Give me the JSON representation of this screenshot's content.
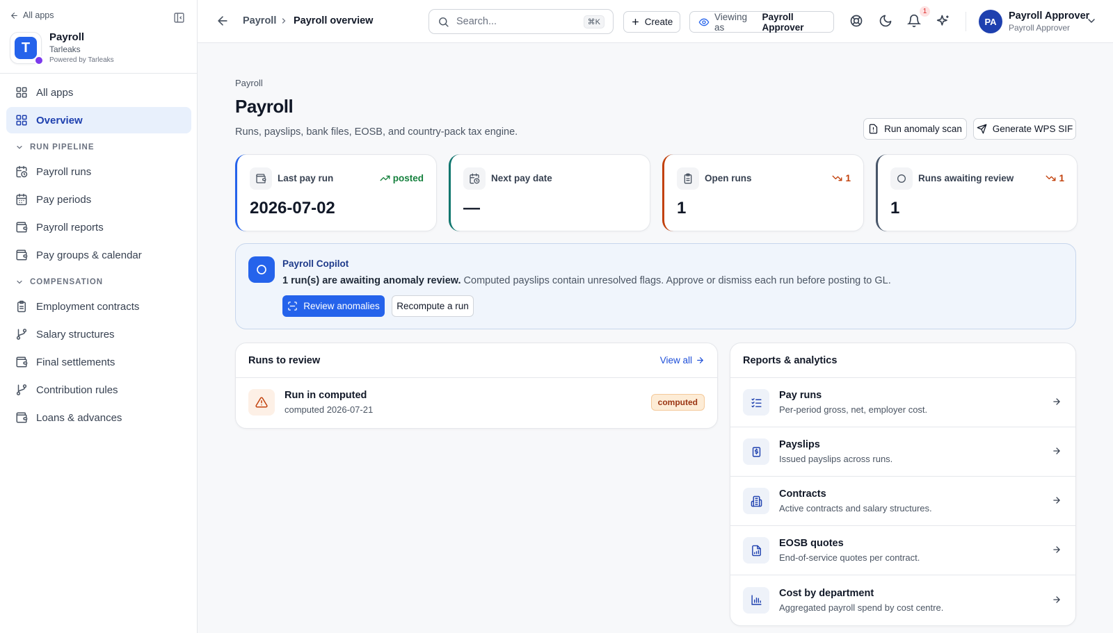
{
  "sidebar": {
    "back_label": "All apps",
    "app": {
      "name": "Payroll",
      "org": "Tarleaks",
      "powered": "Powered by Tarleaks",
      "logo_letter": "T"
    },
    "top_items": [
      {
        "label": "All apps",
        "icon": "grid-icon"
      },
      {
        "label": "Overview",
        "icon": "grid-icon",
        "active": true
      }
    ],
    "sections": [
      {
        "title": "RUN PIPELINE",
        "items": [
          {
            "label": "Payroll runs",
            "icon": "calendar-clock-icon"
          },
          {
            "label": "Pay periods",
            "icon": "calendar-icon"
          },
          {
            "label": "Payroll reports",
            "icon": "wallet-icon"
          },
          {
            "label": "Pay groups & calendar",
            "icon": "wallet-icon"
          }
        ]
      },
      {
        "title": "COMPENSATION",
        "items": [
          {
            "label": "Employment contracts",
            "icon": "clipboard-icon"
          },
          {
            "label": "Salary structures",
            "icon": "branch-icon"
          },
          {
            "label": "Final settlements",
            "icon": "wallet-icon"
          },
          {
            "label": "Contribution rules",
            "icon": "branch-icon"
          },
          {
            "label": "Loans & advances",
            "icon": "wallet-icon"
          }
        ]
      }
    ]
  },
  "header": {
    "breadcrumb_parent": "Payroll",
    "breadcrumb_current": "Payroll overview",
    "search_placeholder": "Search...",
    "search_shortcut": "⌘K",
    "create_label": "Create",
    "viewing_label": "Viewing as",
    "viewing_role": "Payroll Approver",
    "notification_count": "1",
    "user": {
      "initials": "PA",
      "name": "Payroll Approver",
      "role": "Payroll Approver"
    }
  },
  "page": {
    "breadcrumb": "Payroll",
    "title": "Payroll",
    "subtitle": "Runs, payslips, bank files, EOSB, and country-pack tax engine.",
    "actions": {
      "scan": "Run anomaly scan",
      "wps": "Generate WPS SIF"
    }
  },
  "kpis": [
    {
      "label": "Last pay run",
      "value": "2026-07-02",
      "trend": "posted",
      "trend_dir": "up",
      "accent": "#2563eb",
      "trend_color": "#15803d",
      "icon": "wallet-icon"
    },
    {
      "label": "Next pay date",
      "value": "—",
      "trend": "",
      "trend_dir": "",
      "accent": "#0f766e",
      "trend_color": "#15803d",
      "icon": "calendar-clock-icon"
    },
    {
      "label": "Open runs",
      "value": "1",
      "trend": "1",
      "trend_dir": "down",
      "accent": "#c2410c",
      "trend_color": "#c2410c",
      "icon": "clipboard-icon"
    },
    {
      "label": "Runs awaiting review",
      "value": "1",
      "trend": "1",
      "trend_dir": "down",
      "accent": "#475569",
      "trend_color": "#c2410c",
      "icon": "circle-icon"
    }
  ],
  "copilot": {
    "title": "Payroll Copilot",
    "message_bold": "1 run(s) are awaiting anomaly review.",
    "message_rest": " Computed payslips contain unresolved flags. Approve or dismiss each run before posting to GL.",
    "primary": "Review anomalies",
    "secondary": "Recompute a run"
  },
  "runs_card": {
    "title": "Runs to review",
    "view_all": "View all",
    "items": [
      {
        "title": "Run in computed",
        "subtitle": "computed 2026-07-21",
        "status": "computed"
      }
    ]
  },
  "reports_card": {
    "title": "Reports & analytics",
    "items": [
      {
        "title": "Pay runs",
        "subtitle": "Per-period gross, net, employer cost.",
        "icon": "list-check-icon"
      },
      {
        "title": "Payslips",
        "subtitle": "Issued payslips across runs.",
        "icon": "receipt-icon"
      },
      {
        "title": "Contracts",
        "subtitle": "Active contracts and salary structures.",
        "icon": "building-icon"
      },
      {
        "title": "EOSB quotes",
        "subtitle": "End-of-service quotes per contract.",
        "icon": "file-chart-icon"
      },
      {
        "title": "Cost by department",
        "subtitle": "Aggregated payroll spend by cost centre.",
        "icon": "bar-chart-icon"
      }
    ]
  },
  "colors": {
    "primary": "#2563eb",
    "active_bg": "#e8f0fc",
    "warning": "#c2410c",
    "success": "#15803d"
  }
}
